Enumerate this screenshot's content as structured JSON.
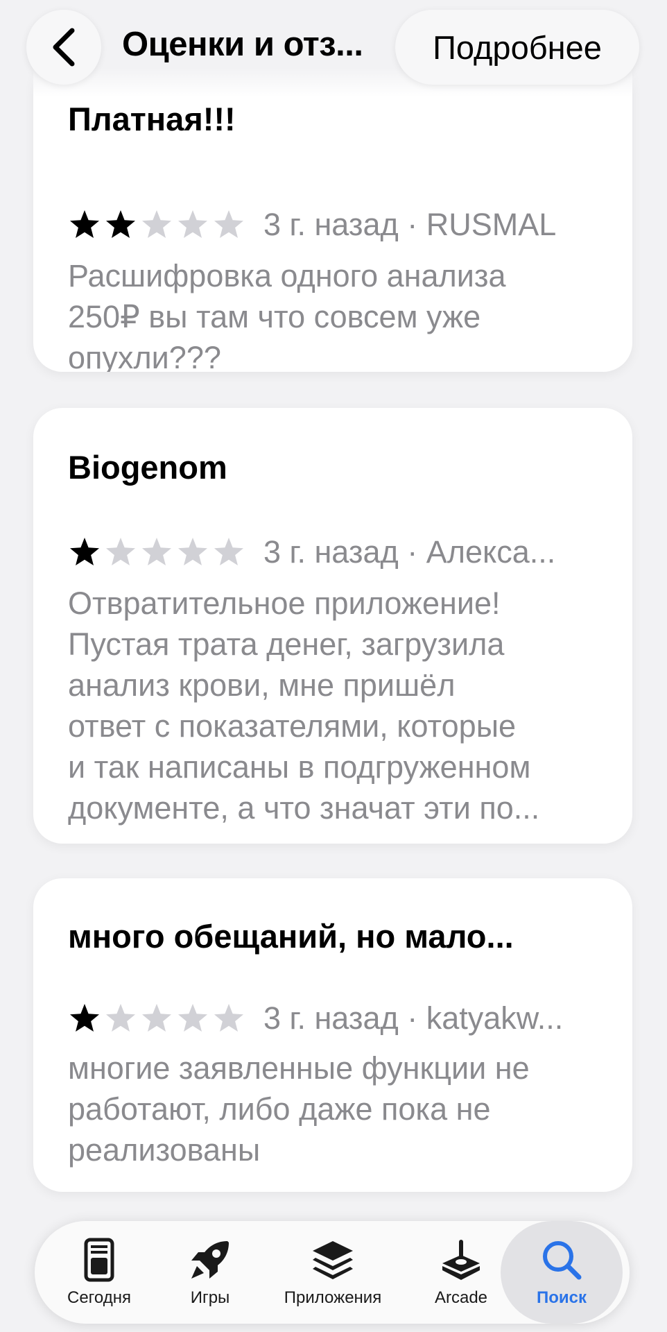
{
  "nav": {
    "title": "Оценки и отз...",
    "more_label": "Подробнее"
  },
  "reviews": [
    {
      "title": "Платная!!!",
      "rating": 2,
      "meta": "3 г. назад · RUSMAL",
      "lines": [
        "Расшифровка одного анализа",
        "250₽ вы там что совсем уже",
        "опухли???"
      ]
    },
    {
      "title": "Biogenom",
      "rating": 1,
      "meta": "3 г. назад · Алекса...",
      "lines": [
        "Отвратительное приложение!",
        "Пустая трата денег, загрузила",
        "анализ крови, мне пришёл",
        "ответ с показателями, которые",
        "и так написаны в подгруженном",
        "документе, а что значат эти по..."
      ]
    },
    {
      "title": "много обещаний, но мало...",
      "rating": 1,
      "meta": "3 г. назад · katyakw...",
      "lines": [
        "многие заявленные функции не",
        "работают, либо даже пока не",
        "реализованы"
      ]
    }
  ],
  "tabbar": {
    "items": [
      {
        "label": "Сегодня",
        "icon": "today-icon"
      },
      {
        "label": "Игры",
        "icon": "rocket-icon"
      },
      {
        "label": "Приложения",
        "icon": "apps-stack-icon"
      },
      {
        "label": "Arcade",
        "icon": "joystick-icon"
      },
      {
        "label": "Поиск",
        "icon": "search-icon",
        "active": true
      }
    ]
  },
  "colors": {
    "accent": "#2a73e8",
    "secondary_text": "#8a8a8e",
    "star_filled": "#000000",
    "star_empty": "#d1d1d6"
  }
}
